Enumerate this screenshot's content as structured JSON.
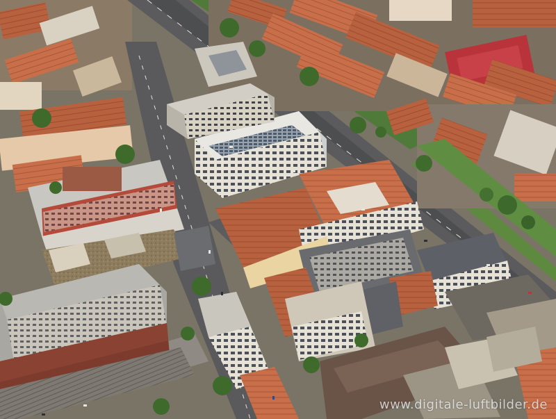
{
  "photo": {
    "watermark": "www.digitale-luftbilder.de"
  }
}
